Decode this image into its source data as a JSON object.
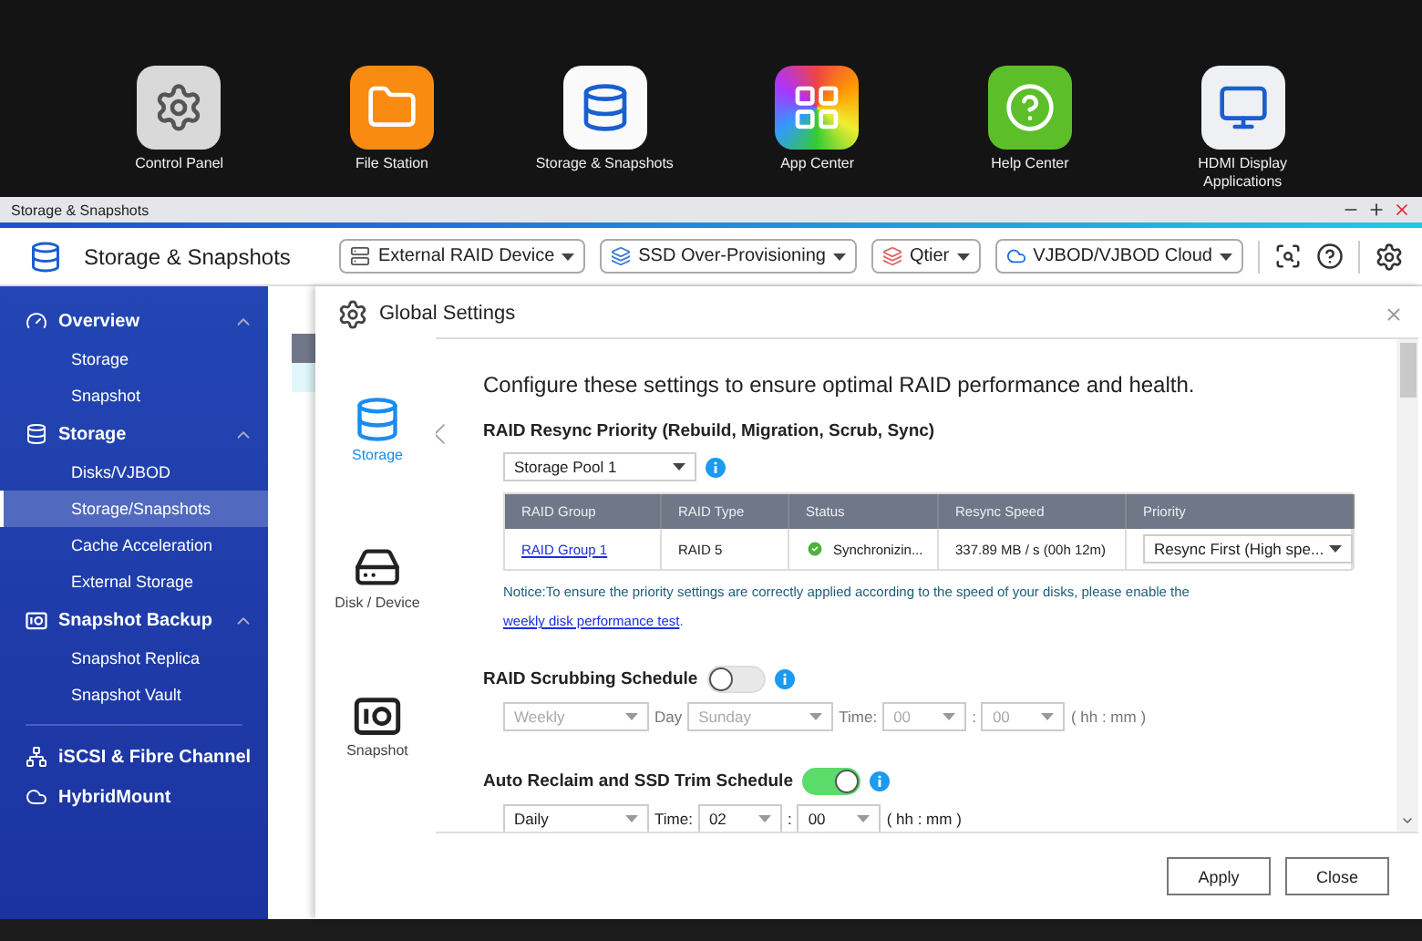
{
  "desktop": {
    "icons": [
      {
        "label": "Control Panel",
        "kind": "control"
      },
      {
        "label": "File Station",
        "kind": "files"
      },
      {
        "label": "Storage & Snapshots",
        "kind": "storage"
      },
      {
        "label": "App Center",
        "kind": "apps"
      },
      {
        "label": "Help Center",
        "kind": "help"
      },
      {
        "label": "HDMI Display Applications",
        "kind": "hdmi"
      }
    ]
  },
  "window": {
    "title": "Storage & Snapshots"
  },
  "header": {
    "title": "Storage & Snapshots",
    "tools": [
      {
        "label": "External RAID Device",
        "kind": "raid"
      },
      {
        "label": "SSD Over-Provisioning",
        "kind": "ssd"
      },
      {
        "label": "Qtier",
        "kind": "qtier"
      },
      {
        "label": "VJBOD/VJBOD Cloud",
        "kind": "cloud"
      }
    ]
  },
  "sidebar": {
    "sections": [
      {
        "label": "Overview",
        "kind": "overview",
        "expanded": true,
        "children": [
          {
            "label": "Storage",
            "selected": false
          },
          {
            "label": "Snapshot",
            "selected": false
          }
        ]
      },
      {
        "label": "Storage",
        "kind": "storage",
        "expanded": true,
        "children": [
          {
            "label": "Disks/VJBOD",
            "selected": false
          },
          {
            "label": "Storage/Snapshots",
            "selected": true
          },
          {
            "label": "Cache Acceleration",
            "selected": false
          },
          {
            "label": "External Storage",
            "selected": false
          }
        ]
      },
      {
        "label": "Snapshot Backup",
        "kind": "snapshot",
        "expanded": true,
        "children": [
          {
            "label": "Snapshot Replica",
            "selected": false
          },
          {
            "label": "Snapshot Vault",
            "selected": false
          }
        ]
      }
    ],
    "extra_items": [
      {
        "label": "iSCSI & Fibre Channel",
        "kind": "iscsi"
      },
      {
        "label": "HybridMount",
        "kind": "hybrid"
      }
    ]
  },
  "dialog": {
    "title": "Global Settings",
    "nav": [
      {
        "label": "Storage",
        "kind": "storage",
        "selected": true
      },
      {
        "label": "Disk / Device",
        "kind": "disk",
        "selected": false
      },
      {
        "label": "Snapshot",
        "kind": "snapshot",
        "selected": false
      }
    ],
    "intro": "Configure these settings to ensure optimal RAID performance and health.",
    "resync": {
      "heading": "RAID Resync Priority (Rebuild, Migration, Scrub, Sync)",
      "pool": "Storage Pool 1",
      "columns": [
        "RAID Group",
        "RAID Type",
        "Status",
        "Resync Speed",
        "Priority"
      ],
      "rows": [
        {
          "raid_group": "RAID Group 1",
          "raid_type": "RAID 5",
          "status": "Synchronizin...",
          "resync_speed": "337.89 MB / s (00h 12m)",
          "priority": "Resync First (High spe..."
        }
      ],
      "notice": "Notice:To ensure the priority settings are correctly applied according to the speed of your disks, please enable the ",
      "notice_link": "weekly disk performance test",
      "notice_end": "."
    },
    "schedules": [
      {
        "label": "RAID Scrubbing Schedule",
        "on": false,
        "frequency": "Weekly",
        "day_label": "Day",
        "day": "Sunday",
        "time_label": "Time:",
        "hour": "00",
        "separator": ":",
        "minute": "00",
        "unit": "( hh : mm )"
      },
      {
        "label": "Auto Reclaim and SSD Trim Schedule",
        "on": true,
        "frequency": "Daily",
        "time_label": "Time:",
        "hour": "02",
        "separator": ":",
        "minute": "00",
        "unit": "( hh : mm )"
      }
    ],
    "buttons": [
      "Apply",
      "Close"
    ]
  }
}
